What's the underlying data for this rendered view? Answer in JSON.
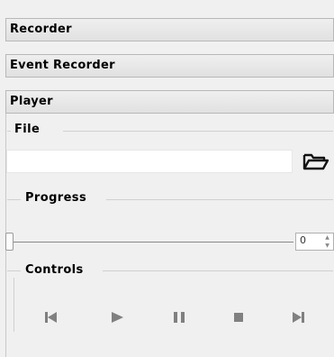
{
  "sections": {
    "recorder": "Recorder",
    "event_recorder": "Event Recorder",
    "player": "Player"
  },
  "player": {
    "file": {
      "title": "File",
      "value": "",
      "placeholder": "",
      "browse_icon": "folder-open-icon"
    },
    "progress": {
      "title": "Progress",
      "slider_fraction": 0,
      "spin_value": "0"
    },
    "controls": {
      "title": "Controls",
      "icons": [
        "skip-to-start-icon",
        "play-icon",
        "pause-icon",
        "stop-icon",
        "skip-to-end-icon"
      ],
      "icon_color": "#808080"
    }
  }
}
